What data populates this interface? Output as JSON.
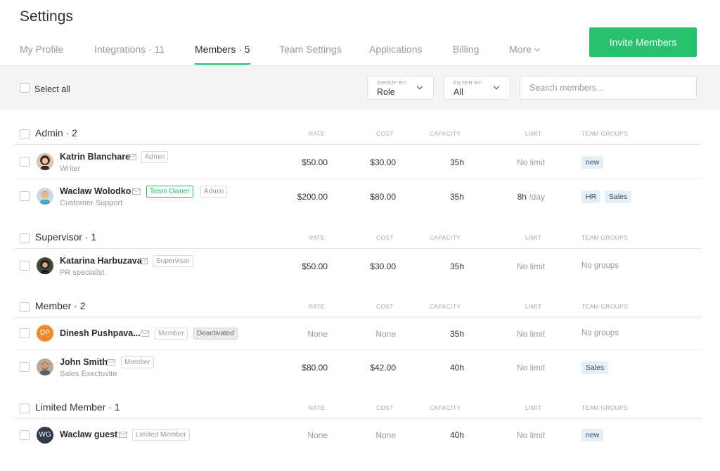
{
  "page": {
    "title": "Settings"
  },
  "tabs": [
    {
      "label": "My Profile"
    },
    {
      "label": "Integrations · 11"
    },
    {
      "label": "Members · 5",
      "active": true
    },
    {
      "label": "Team Settings"
    },
    {
      "label": "Applications"
    },
    {
      "label": "Billing"
    },
    {
      "label": "More"
    }
  ],
  "invite_button": "Invite Members",
  "toolbar": {
    "select_all": "Select all",
    "group_by": {
      "caption": "GROUP BY:",
      "value": "Role"
    },
    "filter_by": {
      "caption": "FILTER BY:",
      "value": "All"
    },
    "search_placeholder": "Search members..."
  },
  "columns": {
    "rate": "RATE",
    "cost": "COST",
    "capacity": "CAPACITY",
    "limit": "LIMIT",
    "team_groups": "TEAM GROUPS"
  },
  "groups": [
    {
      "title": "Admin · 2",
      "members": [
        {
          "name": "Katrin Blanchare",
          "subtitle": "Writer",
          "badges": [
            "Admin"
          ],
          "rate": "$50.00",
          "cost": "$30.00",
          "capacity": "35h",
          "limit": "No limit",
          "groups": [
            "new"
          ],
          "avatar": "photo-woman-icon"
        },
        {
          "name": "Waclaw Wolodko",
          "subtitle": "Customer Support",
          "badges": [
            "Team Owner",
            "Admin"
          ],
          "rate": "$200.00",
          "cost": "$80.00",
          "capacity": "35h",
          "limit": "8h",
          "limit_unit": "/day",
          "groups": [
            "HR",
            "Sales"
          ],
          "avatar": "photo-man-icon"
        }
      ]
    },
    {
      "title": "Supervisor · 1",
      "members": [
        {
          "name": "Katarina Harbuzava",
          "subtitle": "PR specialist",
          "badges": [
            "Supervisor"
          ],
          "rate": "$50.00",
          "cost": "$30.00",
          "capacity": "35h",
          "limit": "No limit",
          "groups": [],
          "no_groups": "No groups",
          "avatar": "photo-woman-icon"
        }
      ]
    },
    {
      "title": "Member · 2",
      "members": [
        {
          "name": "Dinesh Pushpava...",
          "subtitle": "",
          "badges": [
            "Member",
            "Deactivated"
          ],
          "rate": "None",
          "cost": "None",
          "capacity": "35h",
          "limit": "No limit",
          "groups": [],
          "no_groups": "No groups",
          "initials": "DP",
          "avatar_color": "#f0892b"
        },
        {
          "name": "John Smith",
          "subtitle": "Sales Exectuvite",
          "badges": [
            "Member"
          ],
          "rate": "$80.00",
          "cost": "$42.00",
          "capacity": "40h",
          "limit": "No limit",
          "groups": [
            "Sales"
          ],
          "avatar": "photo-man-icon"
        }
      ]
    },
    {
      "title": "Limited Member · 1",
      "members": [
        {
          "name": "Waclaw guest",
          "subtitle": "",
          "badges": [
            "Limited Member"
          ],
          "rate": "None",
          "cost": "None",
          "capacity": "40h",
          "limit": "No limit",
          "groups": [
            "new"
          ],
          "initials": "WG",
          "avatar_color": "#2f3a4a"
        }
      ]
    }
  ],
  "colors": {
    "accent": "#25c16f",
    "tag_bg": "#e5eff9"
  }
}
